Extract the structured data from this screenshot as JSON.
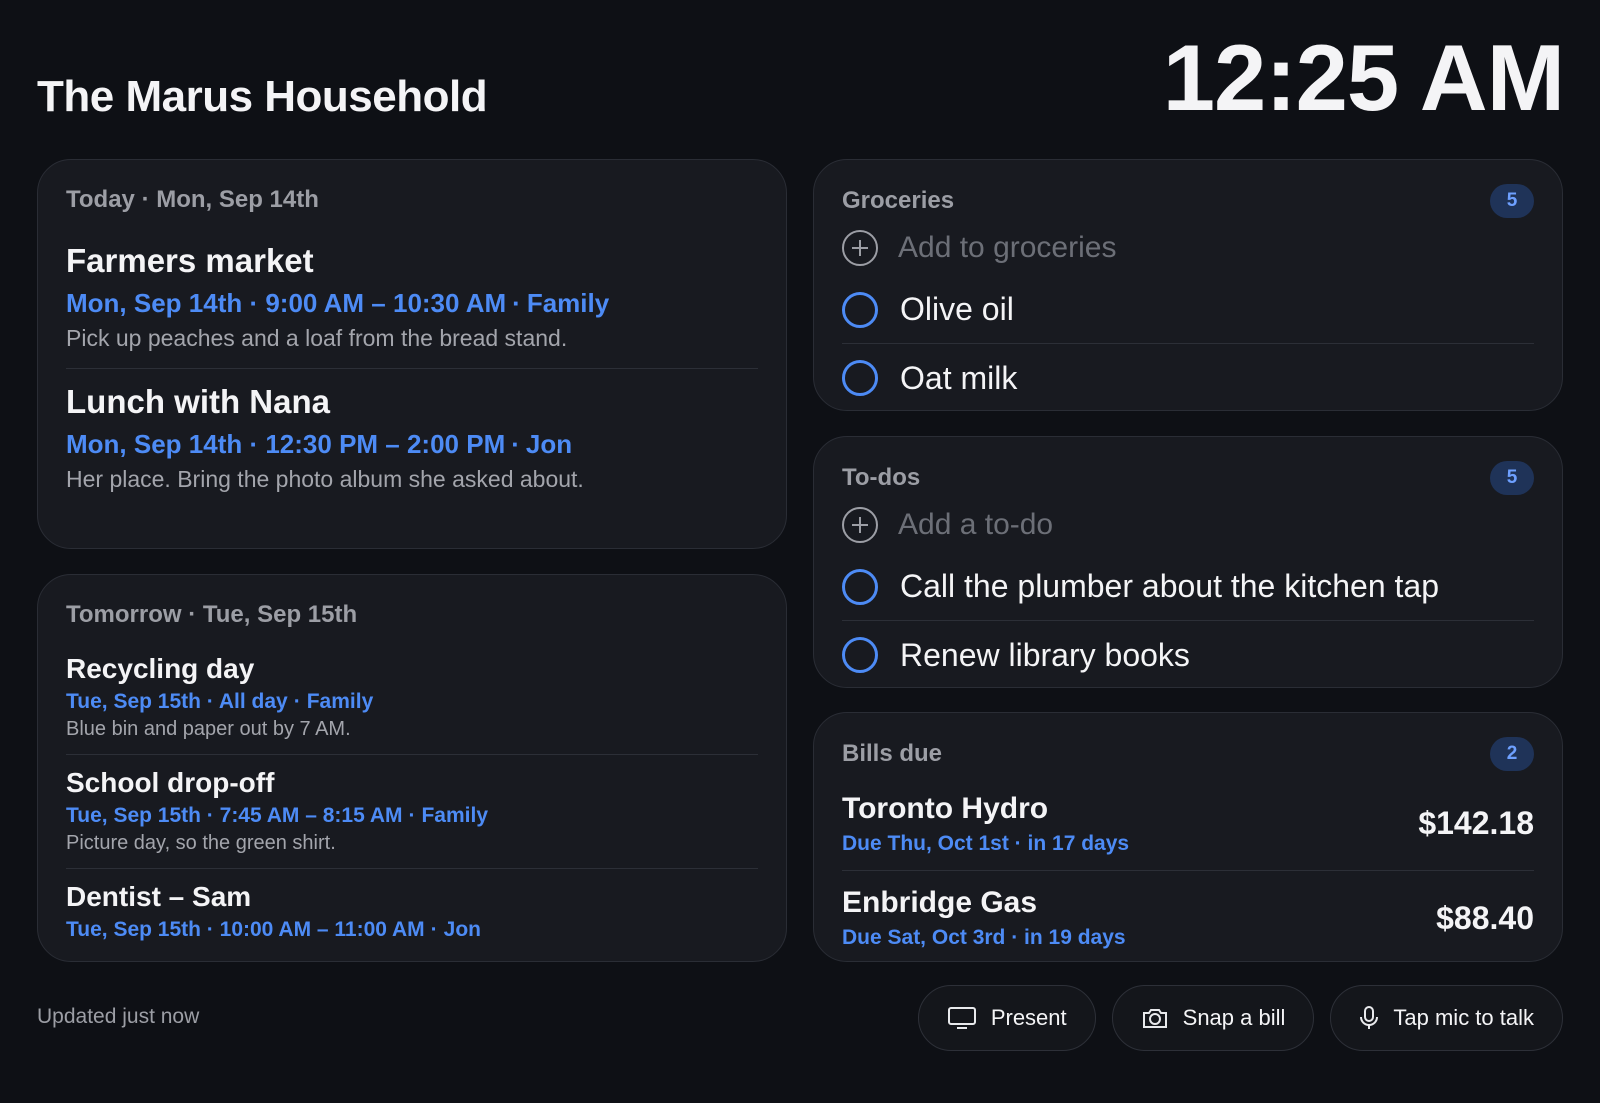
{
  "header": {
    "title": "The Marus Household",
    "clock": "12:25 AM"
  },
  "today": {
    "heading": "Today · Mon, Sep 14th",
    "events": [
      {
        "title": "Farmers market",
        "when": "Mon, Sep 14th · 9:00 AM – 10:30 AM",
        "who": "Family",
        "note": "Pick up peaches and a loaf from the bread stand."
      },
      {
        "title": "Lunch with Nana",
        "when": "Mon, Sep 14th · 12:30 PM – 2:00 PM",
        "who": "Jon",
        "note": "Her place. Bring the photo album she asked about."
      }
    ]
  },
  "tomorrow": {
    "heading": "Tomorrow · Tue, Sep 15th",
    "events": [
      {
        "title": "Recycling day",
        "when": "Tue, Sep 15th · All day",
        "who": "Family",
        "note": "Blue bin and paper out by 7 AM."
      },
      {
        "title": "School drop-off",
        "when": "Tue, Sep 15th · 7:45 AM – 8:15 AM",
        "who": "Family",
        "note": "Picture day, so the green shirt."
      },
      {
        "title": "Dentist – Sam",
        "when": "Tue, Sep 15th · 10:00 AM – 11:00 AM",
        "who": "Jon",
        "note": ""
      }
    ]
  },
  "groceries": {
    "heading": "Groceries",
    "count": "5",
    "add_placeholder": "Add to groceries",
    "items": [
      "Olive oil",
      "Oat milk"
    ]
  },
  "todos": {
    "heading": "To-dos",
    "count": "5",
    "add_placeholder": "Add a to-do",
    "items": [
      "Call the plumber about the kitchen tap",
      "Renew library books"
    ]
  },
  "bills": {
    "heading": "Bills due",
    "count": "2",
    "items": [
      {
        "name": "Toronto Hydro",
        "due": "Due Thu, Oct 1st · in 17 days",
        "amount": "$142.18"
      },
      {
        "name": "Enbridge Gas",
        "due": "Due Sat, Oct 3rd · in 19 days",
        "amount": "$88.40"
      }
    ]
  },
  "footer": {
    "updated": "Updated just now",
    "present_label": "Present",
    "snap_label": "Snap a bill",
    "mic_label": "Tap mic to talk",
    "present_icon": "monitor-icon",
    "snap_icon": "camera-icon",
    "mic_icon": "microphone-icon"
  },
  "colors": {
    "background": "#0e1015",
    "card": "#181a20",
    "accent": "#4d8bf5",
    "muted": "#9c9ea5"
  }
}
